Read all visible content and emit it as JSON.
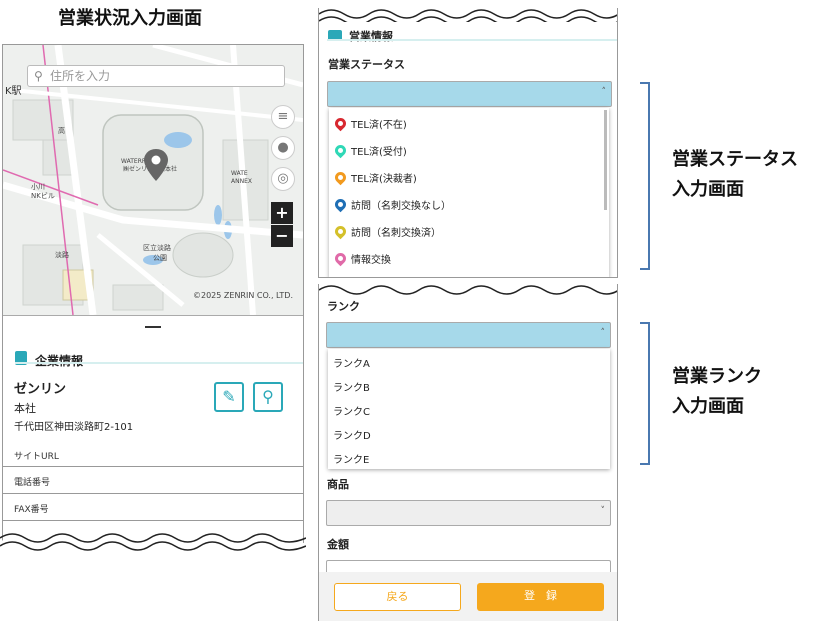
{
  "left_title": "営業状況入力画面",
  "map": {
    "search_placeholder": "住所を入力",
    "station_label": "K駅",
    "copyright": "©2025 ZENRIN CO., LTD.",
    "zoom_in": "+",
    "zoom_out": "−"
  },
  "company": {
    "section_title": "企業情報",
    "name": "ゼンリン",
    "branch": "本社",
    "address": "千代田区神田淡路町2-101",
    "fields": [
      "サイトURL",
      "電話番号",
      "FAX番号"
    ]
  },
  "sales_info": {
    "section_title": "営業情報",
    "status_label": "営業ステータス",
    "status_options": [
      {
        "label": "TEL済(不在)",
        "color": "#d8282f"
      },
      {
        "label": "TEL済(受付)",
        "color": "#2fd8b6"
      },
      {
        "label": "TEL済(決裁者)",
        "color": "#f29a1e"
      },
      {
        "label": "訪問（名刺交換なし）",
        "color": "#1f6fb5"
      },
      {
        "label": "訪問（名刺交換済）",
        "color": "#d4c02a"
      },
      {
        "label": "情報交換",
        "color": "#e06aa8"
      }
    ]
  },
  "rank": {
    "label": "ランク",
    "options": [
      "ランクA",
      "ランクB",
      "ランクC",
      "ランクD",
      "ランクE"
    ]
  },
  "product": {
    "label": "商品"
  },
  "amount": {
    "label": "金額"
  },
  "buttons": {
    "back": "戻る",
    "submit": "登　録"
  },
  "annotations": {
    "status_screen": [
      "営業ステータス",
      "入力画面"
    ],
    "rank_screen": [
      "営業ランク",
      "入力画面"
    ]
  },
  "colors": {
    "accent": "#2aa8b8",
    "submit": "#f5a81d",
    "select_active": "#a6d9ea",
    "bracket": "#4a78b0"
  }
}
